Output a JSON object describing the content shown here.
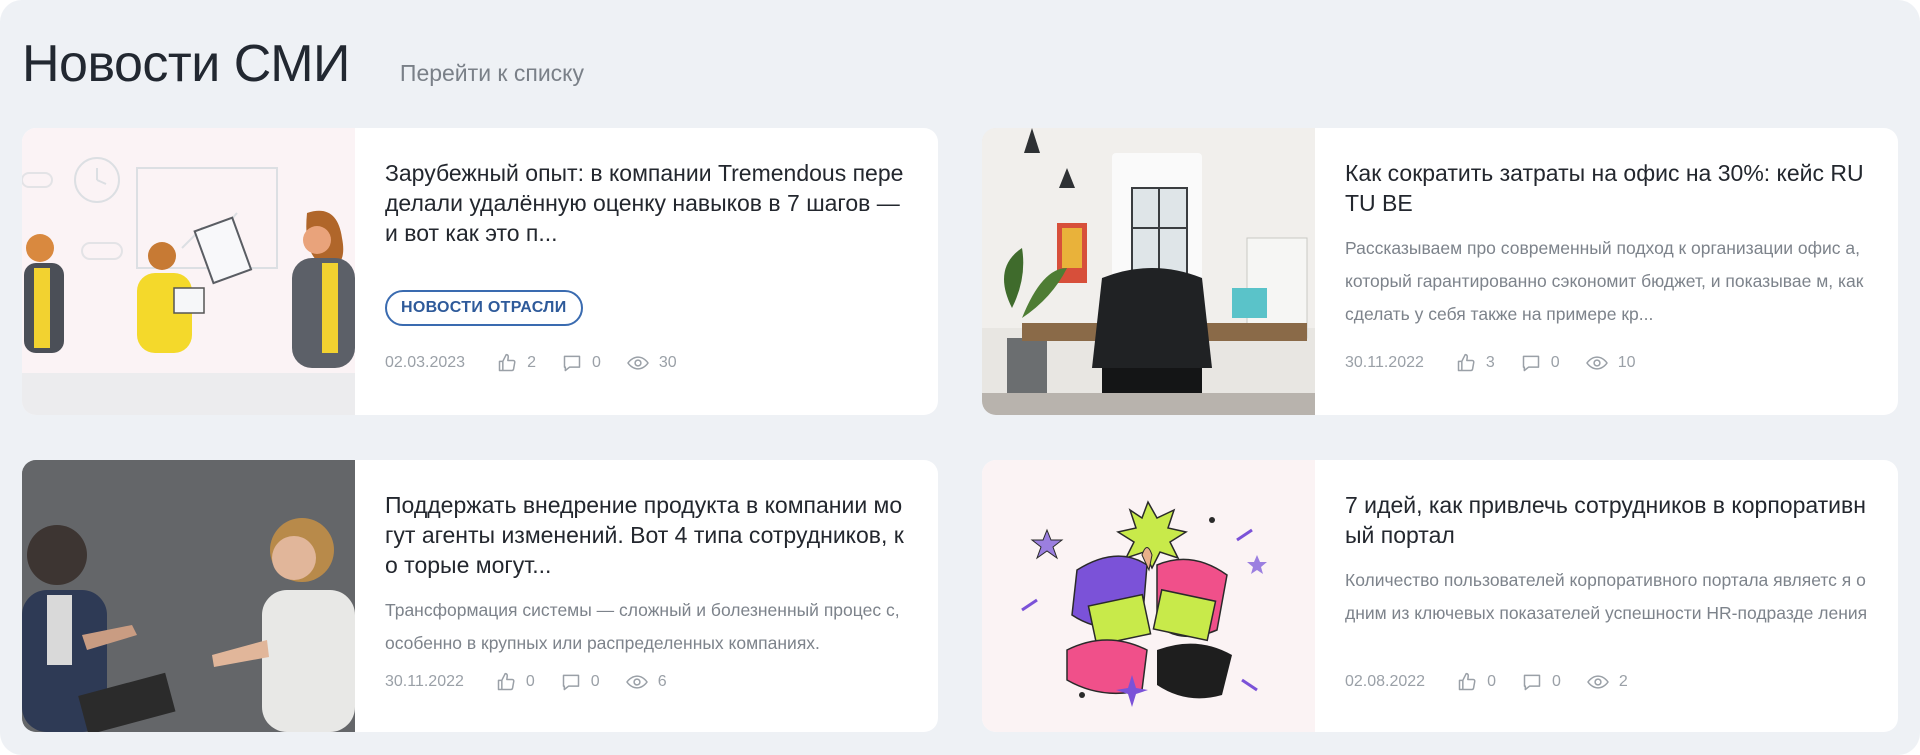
{
  "header": {
    "title": "Новости СМИ",
    "list_link": "Перейти к списку"
  },
  "colors": {
    "background": "#eef1f5",
    "card": "#ffffff",
    "tag_border": "#3a6bb0",
    "meta": "#9aa0a7"
  },
  "cards": [
    {
      "headline": "Зарубежный опыт: в компании Tremendous пере делали удалённую оценку навыков в 7 шагов — и вот как это п...",
      "tag": "НОВОСТИ ОТРАСЛИ",
      "date": "02.03.2023",
      "likes": "2",
      "comments": "0",
      "views": "30"
    },
    {
      "headline": "Как сократить затраты на офис на 30%: кейс RUTU BE",
      "excerpt": "Рассказываем про современный подход к организации офис а, который гарантированно сэкономит бюджет, и показывае м, как сделать у себя также на примере кр...",
      "date": "30.11.2022",
      "likes": "3",
      "comments": "0",
      "views": "10"
    },
    {
      "headline": "Поддержать внедрение продукта в компании мо гут агенты изменений. Вот 4 типа сотрудников, ко торые могут...",
      "excerpt": "Трансформация системы — сложный и болезненный процес с, особенно в крупных или распределенных компаниях.",
      "date": "30.11.2022",
      "likes": "0",
      "comments": "0",
      "views": "6"
    },
    {
      "headline": "7 идей, как привлечь сотрудников в корпоративн ый портал",
      "excerpt": "Количество пользователей корпоративного портала являетс я одним из ключевых показателей успешности HR-подразде ления",
      "date": "02.08.2022",
      "likes": "0",
      "comments": "0",
      "views": "2"
    }
  ],
  "icons": {
    "like": "thumbs-up-icon",
    "comment": "comment-icon",
    "views": "eye-icon"
  }
}
